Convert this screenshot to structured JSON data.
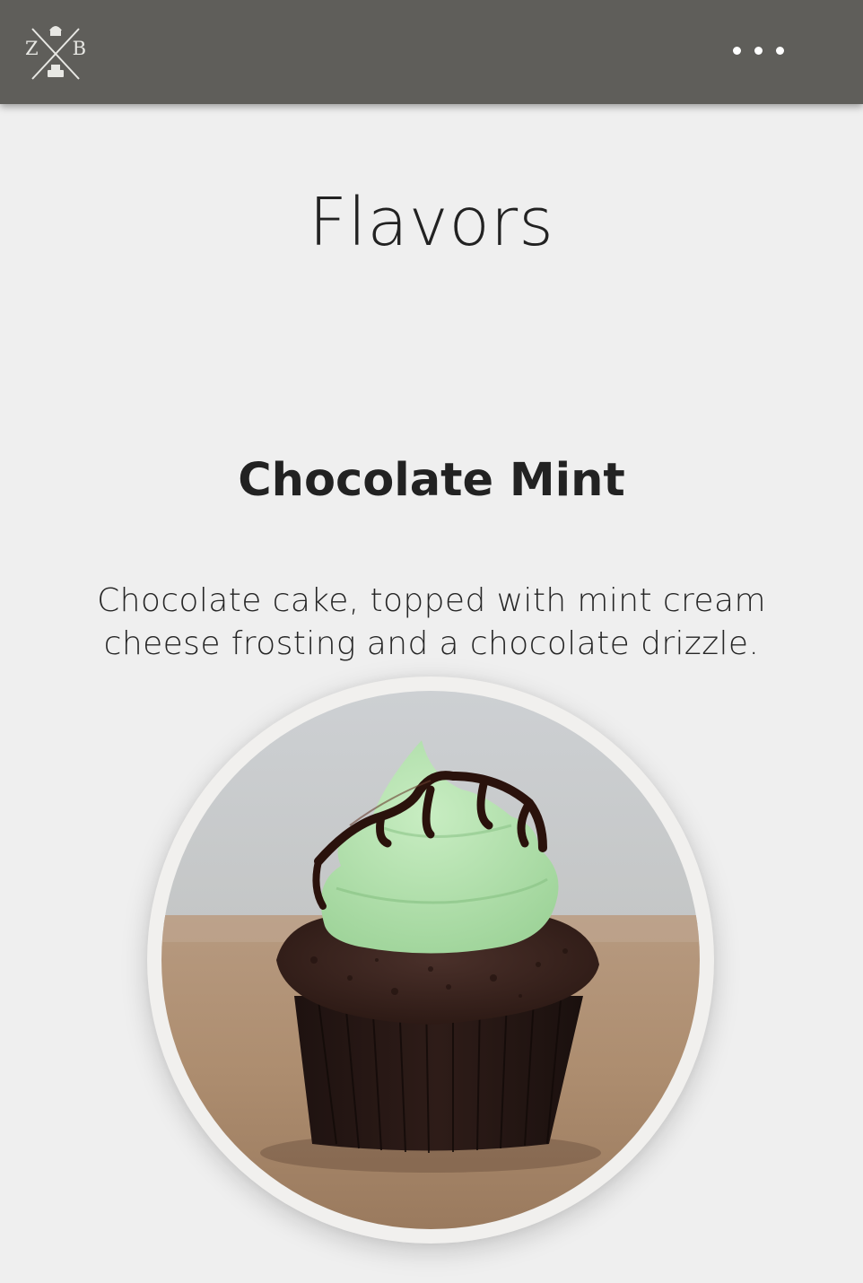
{
  "header": {
    "logo": {
      "letters": [
        "Z",
        "B"
      ],
      "icon": "crossed-whisks-cupcake-logo"
    },
    "menu_icon": "more-horizontal-icon"
  },
  "page": {
    "title": "Flavors"
  },
  "flavor": {
    "name": "Chocolate Mint",
    "description": "Chocolate cake, topped with mint cream cheese frosting and a chocolate drizzle.",
    "image_icon": "chocolate-mint-cupcake-photo"
  },
  "colors": {
    "header_bg": "#5f5e5a",
    "page_bg": "#efefef",
    "text": "#222222",
    "frosting": "#b6e3b0",
    "cake": "#3a2520"
  }
}
